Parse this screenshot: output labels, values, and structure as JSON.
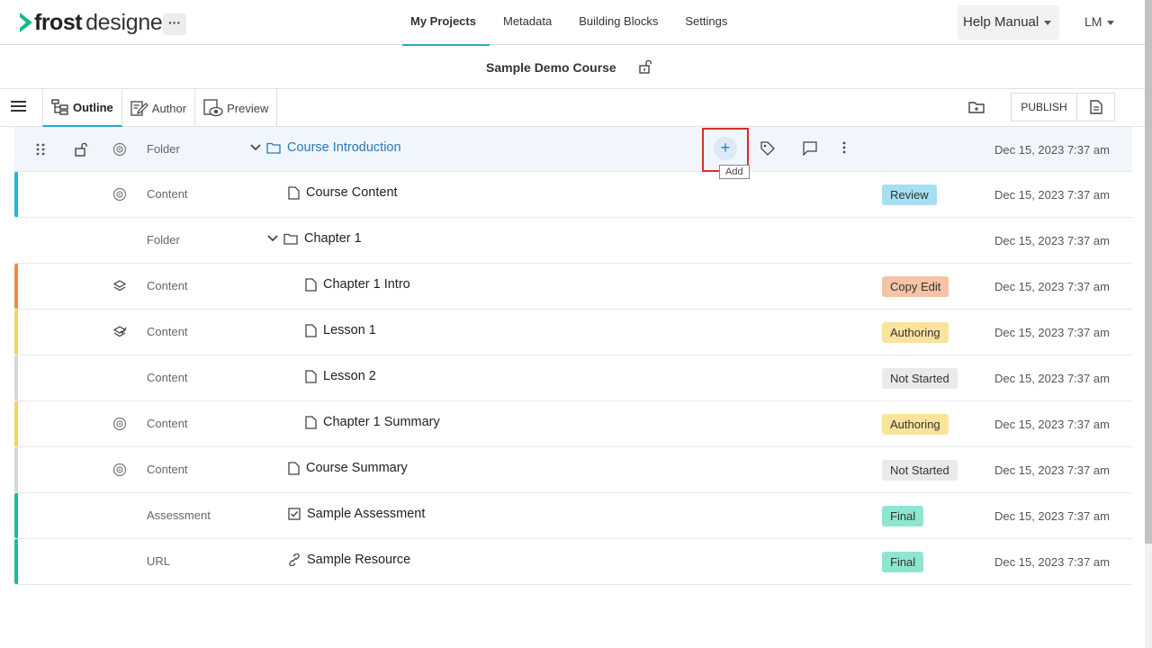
{
  "app": {
    "logo_bold": "frost",
    "logo_light": "designer",
    "more_label": "···"
  },
  "nav": {
    "tabs": [
      {
        "label": "My Projects",
        "active": true
      },
      {
        "label": "Metadata",
        "active": false
      },
      {
        "label": "Building Blocks",
        "active": false
      },
      {
        "label": "Settings",
        "active": false
      }
    ],
    "help_label": "Help Manual",
    "user_initials": "LM"
  },
  "course": {
    "title": "Sample Demo Course"
  },
  "toolbar": {
    "views": [
      {
        "label": "Outline",
        "active": true,
        "icon": "outline-tree-icon"
      },
      {
        "label": "Author",
        "active": false,
        "icon": "author-edit-icon"
      },
      {
        "label": "Preview",
        "active": false,
        "icon": "preview-eye-icon"
      }
    ],
    "publish_label": "PUBLISH"
  },
  "tooltip": {
    "add": "Add"
  },
  "colors": {
    "accent": "#29a9c9",
    "link": "#2a78b7",
    "review": "#a6def3",
    "copy_edit": "#f6c3a4",
    "authoring": "#fbe39c",
    "not_started": "#eaeaea",
    "final": "#8fe6d0",
    "stripe_blue": "#1fb6e4",
    "stripe_orange": "#f38a3b",
    "stripe_yellow": "#f6d35a",
    "stripe_grey": "#d3d8da",
    "stripe_green": "#17c19c"
  },
  "rows": [
    {
      "type": "Folder",
      "name": "Course Introduction",
      "status": "",
      "date": "Dec 15, 2023 7:37 am"
    },
    {
      "type": "Content",
      "name": "Course Content",
      "status": "Review",
      "date": "Dec 15, 2023 7:37 am"
    },
    {
      "type": "Folder",
      "name": "Chapter 1",
      "status": "",
      "date": "Dec 15, 2023 7:37 am"
    },
    {
      "type": "Content",
      "name": "Chapter 1 Intro",
      "status": "Copy Edit",
      "date": "Dec 15, 2023 7:37 am"
    },
    {
      "type": "Content",
      "name": "Lesson 1",
      "status": "Authoring",
      "date": "Dec 15, 2023 7:37 am"
    },
    {
      "type": "Content",
      "name": "Lesson 2",
      "status": "Not Started",
      "date": "Dec 15, 2023 7:37 am"
    },
    {
      "type": "Content",
      "name": "Chapter 1 Summary",
      "status": "Authoring",
      "date": "Dec 15, 2023 7:37 am"
    },
    {
      "type": "Content",
      "name": "Course Summary",
      "status": "Not Started",
      "date": "Dec 15, 2023 7:37 am"
    },
    {
      "type": "Assessment",
      "name": "Sample Assessment",
      "status": "Final",
      "date": "Dec 15, 2023 7:37 am"
    },
    {
      "type": "URL",
      "name": "Sample Resource",
      "status": "Final",
      "date": "Dec 15, 2023 7:37 am"
    }
  ]
}
